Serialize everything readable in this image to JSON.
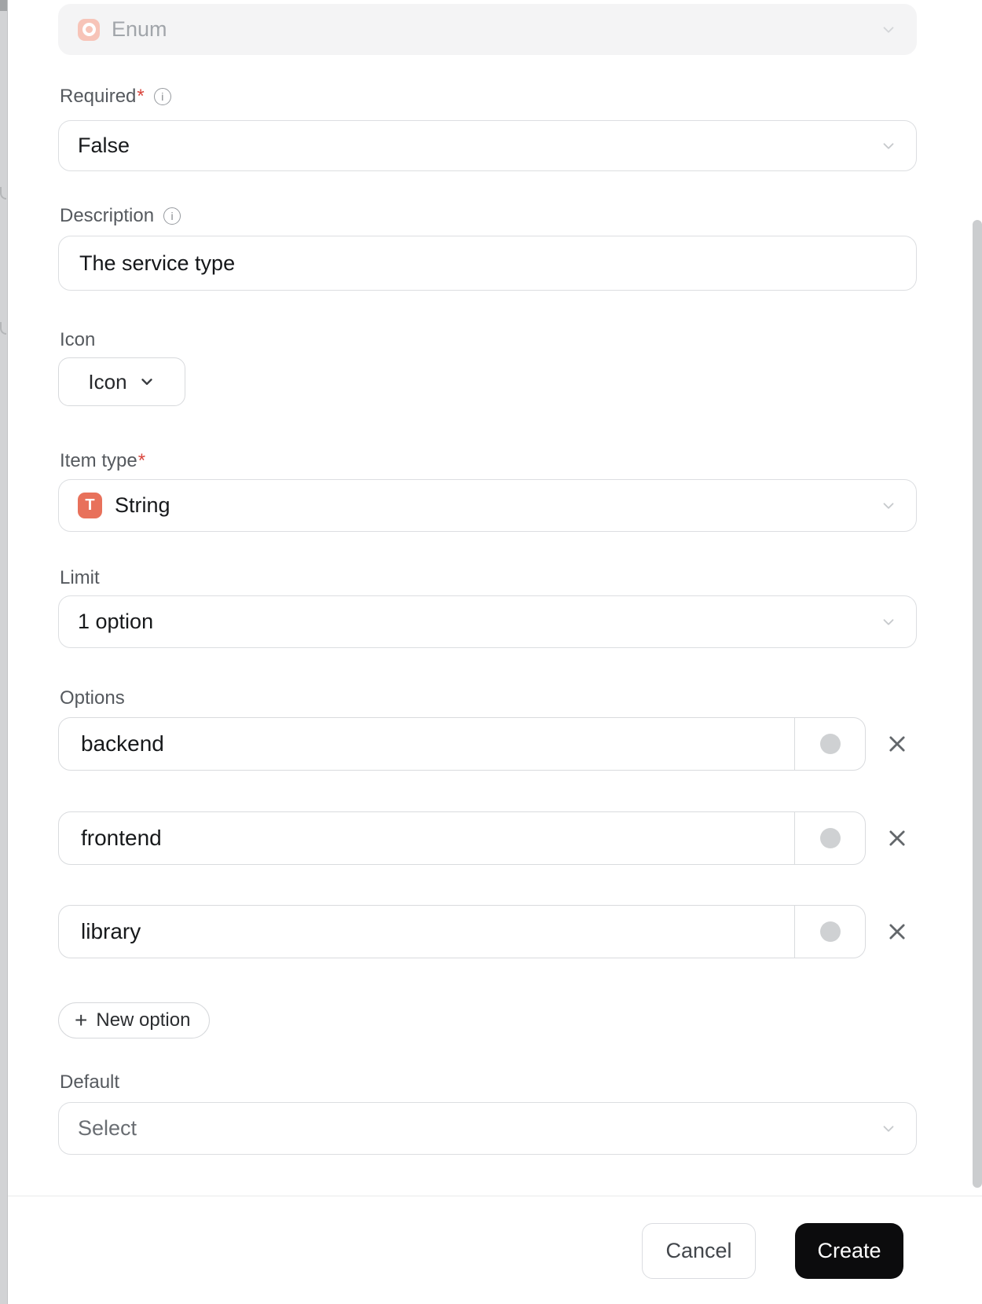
{
  "form": {
    "type_select": {
      "value": "Enum"
    },
    "required": {
      "label": "Required",
      "asterisk": "*",
      "value": "False"
    },
    "description": {
      "label": "Description",
      "value": "The service type"
    },
    "icon": {
      "label": "Icon",
      "button_label": "Icon"
    },
    "item_type": {
      "label": "Item type",
      "asterisk": "*",
      "value": "String",
      "badge": "T"
    },
    "limit": {
      "label": "Limit",
      "value": "1 option"
    },
    "options": {
      "label": "Options",
      "items": [
        {
          "value": "backend"
        },
        {
          "value": "frontend"
        },
        {
          "value": "library"
        }
      ],
      "plus": "+",
      "new_option_label": "New option"
    },
    "default": {
      "label": "Default",
      "placeholder": "Select"
    }
  },
  "footer": {
    "cancel_label": "Cancel",
    "create_label": "Create"
  },
  "icons": {
    "type_select_icon": "record-circle",
    "info": "i",
    "chevron": "chevron-down",
    "remove": "x",
    "plus": "plus",
    "swatch": "color-dot"
  },
  "colors": {
    "accent": "#e8715b",
    "accent_light": "#f7c4b8",
    "required_red": "#d9453c",
    "disabled_bg": "#f4f4f5",
    "border": "#dcdee1",
    "label_text": "#55595e",
    "value_text": "#17191b",
    "swatch_gray": "#cfd1d3",
    "create_bg": "#0c0c0d",
    "scrollbar": "#cbcdcf"
  }
}
